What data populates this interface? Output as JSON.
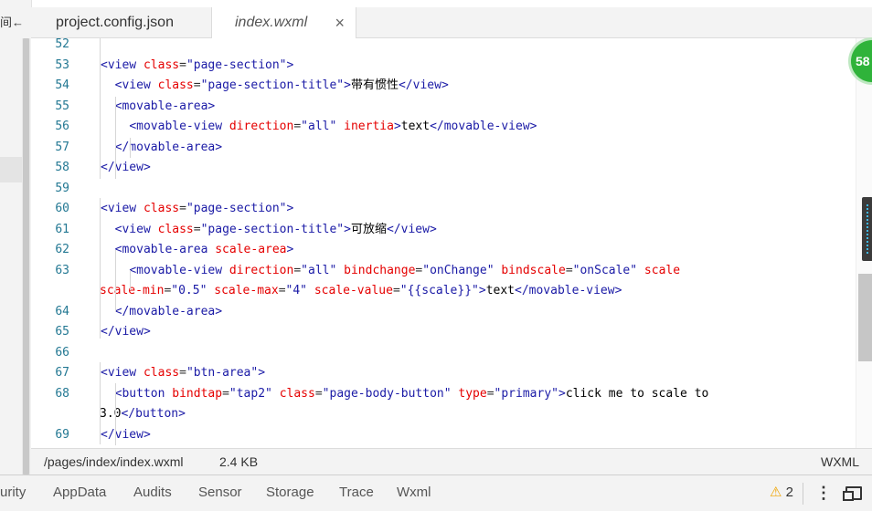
{
  "sidebar": {
    "truncated_label": "间←"
  },
  "tabs": [
    {
      "label": "project.config.json"
    },
    {
      "label": "index.wxml",
      "close_icon": "×"
    }
  ],
  "editor": {
    "lines": [
      {
        "n": "52",
        "html": ""
      },
      {
        "n": "53",
        "html": "<span class='tag'>&lt;view</span> <span class='attr'>class</span>=<span class='val'>\"page-section\"</span><span class='tag'>&gt;</span>"
      },
      {
        "n": "54",
        "html": "  <span class='tag'>&lt;view</span> <span class='attr'>class</span>=<span class='val'>\"page-section-title\"</span><span class='tag'>&gt;</span><span class='txt'>带有惯性</span><span class='tag'>&lt;/view&gt;</span>"
      },
      {
        "n": "55",
        "html": "  <span class='tag'>&lt;movable-area&gt;</span>"
      },
      {
        "n": "56",
        "html": "    <span class='tag'>&lt;movable-view</span> <span class='attr'>direction</span>=<span class='val'>\"all\"</span> <span class='attr'>inertia</span><span class='tag'>&gt;</span><span class='txt'>text</span><span class='tag'>&lt;/movable-view&gt;</span>"
      },
      {
        "n": "57",
        "html": "  <span class='tag'>&lt;/movable-area&gt;</span>"
      },
      {
        "n": "58",
        "html": "<span class='tag'>&lt;/view&gt;</span>"
      },
      {
        "n": "59",
        "html": ""
      },
      {
        "n": "60",
        "html": "<span class='tag'>&lt;view</span> <span class='attr'>class</span>=<span class='val'>\"page-section\"</span><span class='tag'>&gt;</span>"
      },
      {
        "n": "61",
        "html": "  <span class='tag'>&lt;view</span> <span class='attr'>class</span>=<span class='val'>\"page-section-title\"</span><span class='tag'>&gt;</span><span class='txt'>可放缩</span><span class='tag'>&lt;/view&gt;</span>"
      },
      {
        "n": "62",
        "html": "  <span class='tag'>&lt;movable-area</span> <span class='attr'>scale-area</span><span class='tag'>&gt;</span>"
      },
      {
        "n": "63",
        "html": "    <span class='tag'>&lt;movable-view</span> <span class='attr'>direction</span>=<span class='val'>\"all\"</span> <span class='attr'>bindchange</span>=<span class='val'>\"onChange\"</span> <span class='attr'>bindscale</span>=<span class='val'>\"onScale\"</span> <span class='attr'>scale</span>"
      },
      {
        "n": "",
        "html": "<span class='attr'>scale-min</span>=<span class='val'>\"0.5\"</span> <span class='attr'>scale-max</span>=<span class='val'>\"4\"</span> <span class='attr'>scale-value</span>=<span class='val'>\"{{scale}}\"</span><span class='tag'>&gt;</span><span class='txt'>text</span><span class='tag'>&lt;/movable-view&gt;</span>"
      },
      {
        "n": "64",
        "html": "  <span class='tag'>&lt;/movable-area&gt;</span>"
      },
      {
        "n": "65",
        "html": "<span class='tag'>&lt;/view&gt;</span>"
      },
      {
        "n": "66",
        "html": ""
      },
      {
        "n": "67",
        "html": "<span class='tag'>&lt;view</span> <span class='attr'>class</span>=<span class='val'>\"btn-area\"</span><span class='tag'>&gt;</span>"
      },
      {
        "n": "68",
        "html": "  <span class='tag'>&lt;button</span> <span class='attr'>bindtap</span>=<span class='val'>\"tap2\"</span> <span class='attr'>class</span>=<span class='val'>\"page-body-button\"</span> <span class='attr'>type</span>=<span class='val'>\"primary\"</span><span class='tag'>&gt;</span><span class='txt'>click me to scale to</span>"
      },
      {
        "n": "",
        "html": "<span class='txt'>3.0</span><span class='tag'>&lt;/button&gt;</span>"
      },
      {
        "n": "69",
        "html": "<span class='tag'>&lt;/view&gt;</span>"
      }
    ]
  },
  "badge": {
    "value": "58"
  },
  "status": {
    "path": "/pages/index/index.wxml",
    "size": "2.4 KB",
    "language": "WXML"
  },
  "devtools": {
    "tabs": [
      "urity",
      "AppData",
      "Audits",
      "Sensor",
      "Storage",
      "Trace",
      "Wxml"
    ],
    "warning_count": "2"
  },
  "icons": {
    "close": "close-icon",
    "warning": "warning-icon",
    "more": "kebab-menu-icon",
    "dock": "dock-side-icon"
  }
}
